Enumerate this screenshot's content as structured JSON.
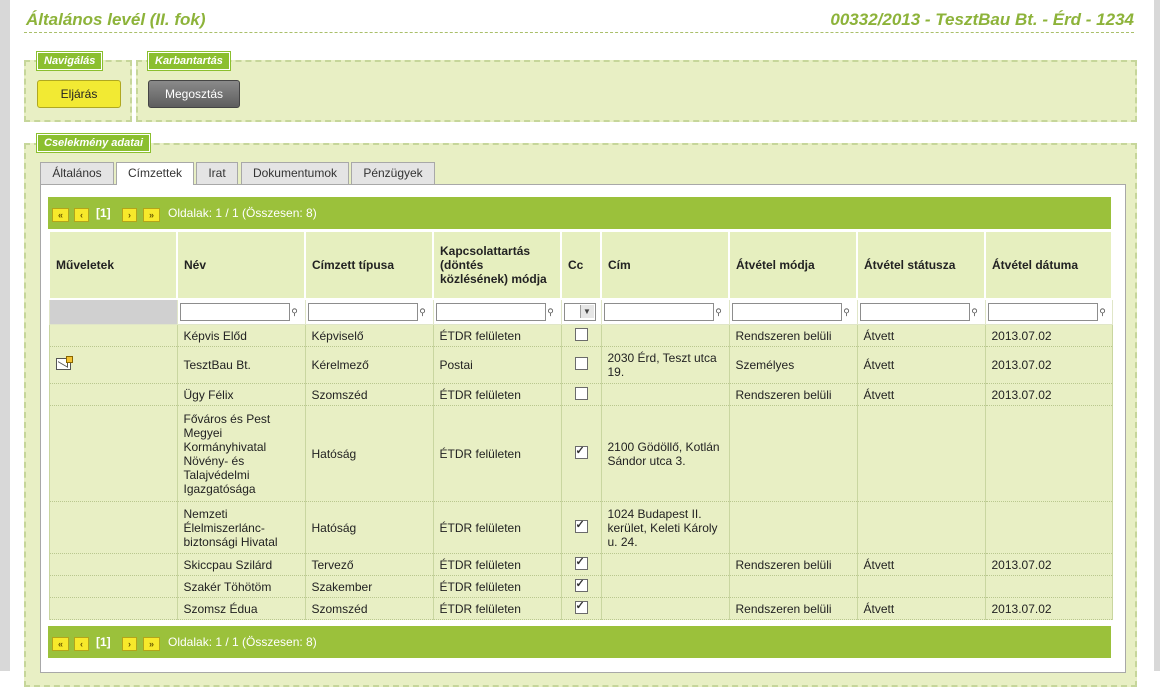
{
  "header": {
    "title": "Általános levél (II. fok)",
    "case_info": "00332/2013 - TesztBau Bt. - Érd - 1234"
  },
  "navigation": {
    "legend": "Navigálás",
    "button": "Eljárás"
  },
  "maintenance": {
    "legend": "Karbantartás",
    "button": "Megosztás"
  },
  "action_data": {
    "legend": "Cselekmény adatai"
  },
  "tabs": [
    "Általános",
    "Címzettek",
    "Irat",
    "Dokumentumok",
    "Pénzügyek"
  ],
  "active_tab": "Címzettek",
  "pager": {
    "first": "«",
    "prev": "‹",
    "current": "[1]",
    "next": "›",
    "last": "»",
    "info": "Oldalak: 1 / 1 (Összesen: 8)"
  },
  "columns": [
    "Műveletek",
    "Név",
    "Címzett típusa",
    "Kapcsolattartás (döntés közlésének) módja",
    "Cc",
    "Cím",
    "Átvétel módja",
    "Átvétel státusza",
    "Átvétel dátuma"
  ],
  "rows": [
    {
      "action_icon": "",
      "name": "Képvis Előd",
      "type": "Képviselő",
      "contact": "ÉTDR felületen",
      "cc": false,
      "address": "",
      "receipt_mode": "Rendszeren belüli",
      "receipt_status": "Átvett",
      "receipt_date": "2013.07.02"
    },
    {
      "action_icon": "mail-edit-icon",
      "name": "TesztBau Bt.",
      "type": "Kérelmező",
      "contact": "Postai",
      "cc": false,
      "address": "2030 Érd, Teszt utca 19.",
      "receipt_mode": "Személyes",
      "receipt_status": "Átvett",
      "receipt_date": "2013.07.02"
    },
    {
      "action_icon": "",
      "name": "Ügy Félix",
      "type": "Szomszéd",
      "contact": "ÉTDR felületen",
      "cc": false,
      "address": "",
      "receipt_mode": "Rendszeren belüli",
      "receipt_status": "Átvett",
      "receipt_date": "2013.07.02"
    },
    {
      "action_icon": "",
      "name": "Főváros és Pest Megyei Kormányhivatal Növény- és Talajvédelmi Igazgatósága",
      "type": "Hatóság",
      "contact": "ÉTDR felületen",
      "cc": true,
      "address": "2100 Gödöllő, Kotlán Sándor utca 3.",
      "receipt_mode": "",
      "receipt_status": "",
      "receipt_date": ""
    },
    {
      "action_icon": "",
      "name": "Nemzeti Élelmiszerlánc-biztonsági Hivatal",
      "type": "Hatóság",
      "contact": "ÉTDR felületen",
      "cc": true,
      "address": "1024 Budapest II. kerület, Keleti Károly u. 24.",
      "receipt_mode": "",
      "receipt_status": "",
      "receipt_date": ""
    },
    {
      "action_icon": "",
      "name": "Skiccpau Szilárd",
      "type": "Tervező",
      "contact": "ÉTDR felületen",
      "cc": true,
      "address": "",
      "receipt_mode": "Rendszeren belüli",
      "receipt_status": "Átvett",
      "receipt_date": "2013.07.02"
    },
    {
      "action_icon": "",
      "name": "Szakér Töhötöm",
      "type": "Szakember",
      "contact": "ÉTDR felületen",
      "cc": true,
      "address": "",
      "receipt_mode": "",
      "receipt_status": "",
      "receipt_date": ""
    },
    {
      "action_icon": "",
      "name": "Szomsz Édua",
      "type": "Szomszéd",
      "contact": "ÉTDR felületen",
      "cc": true,
      "address": "",
      "receipt_mode": "Rendszeren belüli",
      "receipt_status": "Átvett",
      "receipt_date": "2013.07.02"
    }
  ],
  "colors": {
    "accent_green": "#9bc13b",
    "title_green": "#8db33a",
    "panel_bg": "#e8efc4",
    "nav_button": "#f2ea33"
  }
}
